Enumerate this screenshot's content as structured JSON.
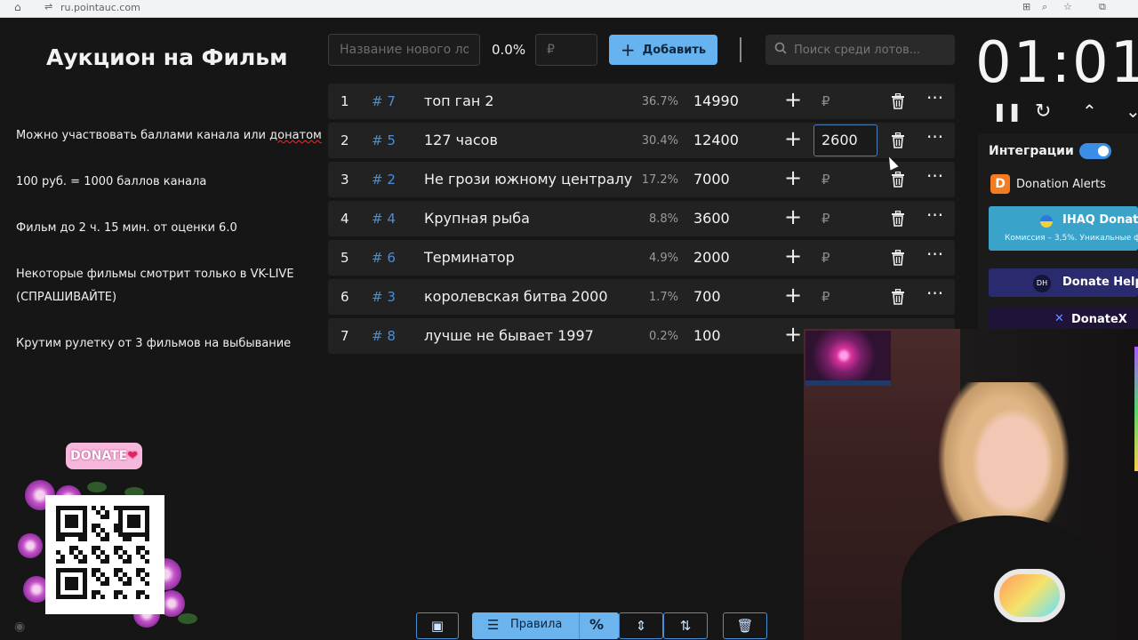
{
  "browser": {
    "url": "ru.pointauc.com"
  },
  "left_panel": {
    "title": "Аукцион на Фильм",
    "info": [
      "Можно участвовать баллами канала или донатом",
      "100 руб. = 1000 баллов канала",
      "Фильм до 2 ч. 15 мин. от оценки 6.0",
      "Некоторые фильмы смотрит только в VK-LIVE",
      "(СПРАШИВАЙТЕ)",
      "Крутим  рулетку от 3 фильмов на выбывание"
    ],
    "info_prefix": "Можно участвовать баллами канала или ",
    "info_underlined": "донатом",
    "donate_label": "DONATE",
    "donate_heart": "❤"
  },
  "controls": {
    "lot_name_placeholder": "Название нового лота",
    "percent": "0.0%",
    "amount_placeholder": "₽",
    "add_label": "Добавить",
    "search_placeholder": "Поиск среди лотов..."
  },
  "lots": [
    {
      "num": "1",
      "id": "# 7",
      "name": "топ ган 2",
      "pct": "36.7%",
      "amount": "14990"
    },
    {
      "num": "2",
      "id": "# 5",
      "name": "127 часов",
      "pct": "30.4%",
      "amount": "12400",
      "edit_value": "2600"
    },
    {
      "num": "3",
      "id": "# 2",
      "name": "Не грози южному централу",
      "pct": "17.2%",
      "amount": "7000"
    },
    {
      "num": "4",
      "id": "# 4",
      "name": "Крупная рыба",
      "pct": "8.8%",
      "amount": "3600"
    },
    {
      "num": "5",
      "id": "# 6",
      "name": "Терминатор",
      "pct": "4.9%",
      "amount": "2000"
    },
    {
      "num": "6",
      "id": "# 3",
      "name": "королевская битва 2000",
      "pct": "1.7%",
      "amount": "700"
    },
    {
      "num": "7",
      "id": "# 8",
      "name": "лучше не бывает 1997",
      "pct": "0.2%",
      "amount": "100"
    }
  ],
  "row_symbols": {
    "plus": "+",
    "rub": "₽",
    "more": "···"
  },
  "toolbar": {
    "rules_label": "Правила",
    "percent_label": "%"
  },
  "timer": {
    "display": "01:01:"
  },
  "integrations": {
    "title": "Интеграции",
    "enabled": true,
    "donation_alerts": "Donation Alerts",
    "da_glyph": "D",
    "ihaq_title": "IHAQ Donate",
    "ihaq_sub": "Комиссия – 3,5%. Уникальные ф",
    "dh_logo": "DH",
    "dh_title": "Donate Helper",
    "dx_glyph": "✕",
    "dx_title": "DonateX"
  },
  "colors": {
    "accent": "#66b3f0",
    "id_tag": "#4a8fd6",
    "row_bg": "#222222",
    "page_bg": "#161616"
  }
}
